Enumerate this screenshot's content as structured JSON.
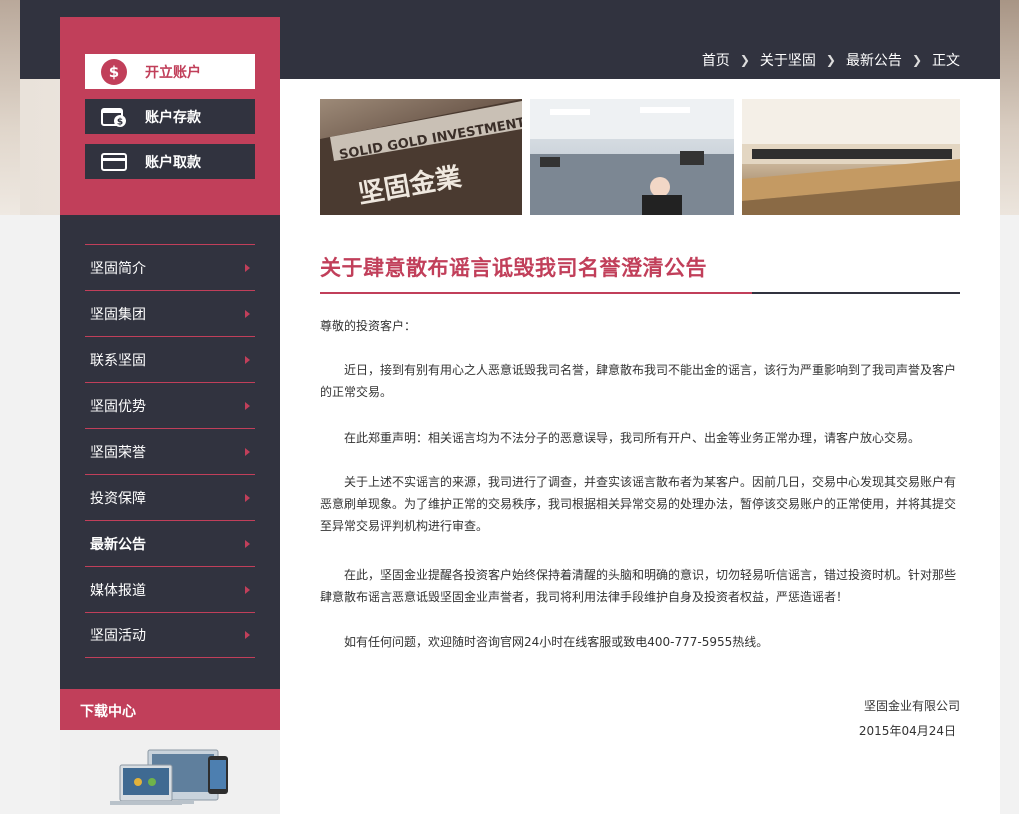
{
  "breadcrumb": [
    "首页",
    "关于坚固",
    "最新公告",
    "正文"
  ],
  "account_buttons": [
    {
      "label": "开立账户",
      "icon": "dollar-coin-icon"
    },
    {
      "label": "账户存款",
      "icon": "wallet-deposit-icon"
    },
    {
      "label": "账户取款",
      "icon": "card-withdraw-icon"
    }
  ],
  "nav": [
    {
      "label": "坚固简介",
      "active": false
    },
    {
      "label": "坚固集团",
      "active": false
    },
    {
      "label": "联系坚固",
      "active": false
    },
    {
      "label": "坚固优势",
      "active": false
    },
    {
      "label": "坚固荣誉",
      "active": false
    },
    {
      "label": "投资保障",
      "active": false
    },
    {
      "label": "最新公告",
      "active": true
    },
    {
      "label": "媒体报道",
      "active": false
    },
    {
      "label": "坚固活动",
      "active": false
    }
  ],
  "download": {
    "title": "下载中心"
  },
  "banner": {
    "sign_text": "SOLID GOLD INVESTMENT",
    "sign_cn": "坚固金業"
  },
  "article": {
    "title": "关于肆意散布谣言诋毁我司名誉澄清公告",
    "greeting": "尊敬的投资客户：",
    "p1": "近日，接到有别有用心之人恶意诋毁我司名誉，肆意散布我司不能出金的谣言，该行为严重影响到了我司声誉及客户的正常交易。",
    "p2": "在此郑重声明：相关谣言均为不法分子的恶意误导，我司所有开户、出金等业务正常办理，请客户放心交易。",
    "p3": "关于上述不实谣言的来源，我司进行了调查，并查实该谣言散布者为某客户。因前几日，交易中心发现其交易账户有恶意刷单现象。为了维护正常的交易秩序，我司根据相关异常交易的处理办法，暂停该交易账户的正常使用，并将其提交至异常交易评判机构进行审查。",
    "p4": "在此，坚固金业提醒各投资客户始终保持着清醒的头脑和明确的意识，切勿轻易听信谣言，错过投资时机。针对那些肆意散布谣言恶意诋毁坚固金业声誉者，我司将利用法律手段维护自身及投资者权益，严惩造谣者！",
    "p5": "如有任何问题，欢迎随时咨询官网24小时在线客服或致电400-777-5955热线。",
    "company": "坚固金业有限公司",
    "date": "2015年04月24日"
  },
  "colors": {
    "accent": "#c13f5a",
    "dark": "#31333f",
    "white": "#ffffff"
  }
}
